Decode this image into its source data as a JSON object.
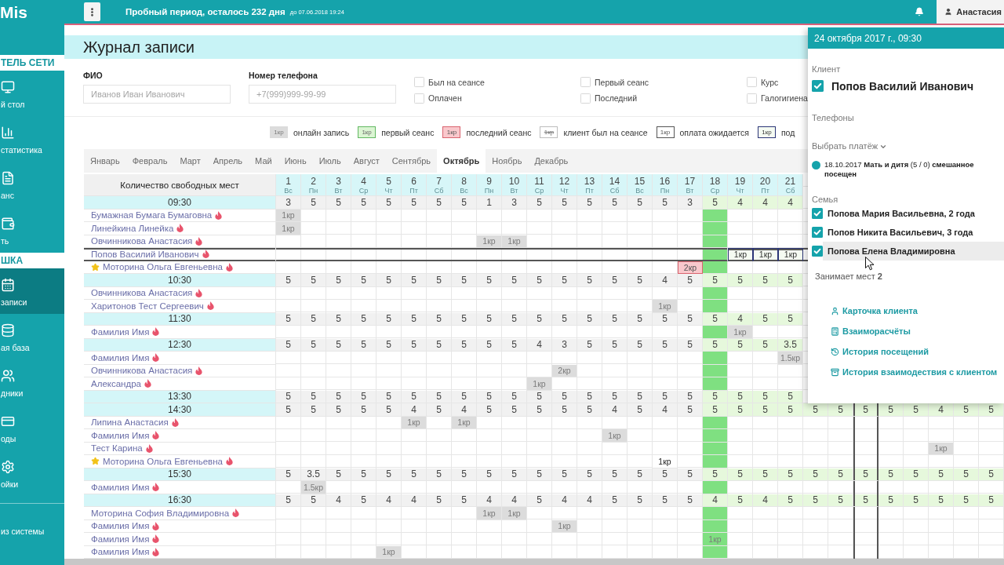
{
  "sidebar": {
    "logo": "Mis",
    "items": [
      {
        "kind": "header",
        "label": "ТЕЛЬ СЕТИ"
      },
      {
        "kind": "link",
        "label": "й стол",
        "selected": false
      },
      {
        "kind": "link",
        "label": "статистика",
        "selected": false
      },
      {
        "kind": "link",
        "label": "анс",
        "selected": false
      },
      {
        "kind": "link",
        "label": "ть",
        "selected": false
      },
      {
        "kind": "header",
        "label": "ШКА"
      },
      {
        "kind": "link",
        "label": "записи",
        "selected": true
      },
      {
        "kind": "link",
        "label": "ая база",
        "selected": false
      },
      {
        "kind": "link",
        "label": "дники",
        "selected": false
      },
      {
        "kind": "link",
        "label": "оды",
        "selected": false
      },
      {
        "kind": "link",
        "label": "ойки",
        "selected": false
      },
      {
        "kind": "footer",
        "label": "из системы",
        "selected": false
      }
    ]
  },
  "top_bar": {
    "trial_notice": "Пробный период, осталось 232 дня",
    "trial_end": "до 07.06.2018 19:24",
    "user": "Анастасия"
  },
  "page_title": "Журнал записи",
  "filters": {
    "fields": [
      {
        "label": "ФИО",
        "placeholder": "Иванов Иван Иванович"
      },
      {
        "label": "Номер телефона",
        "placeholder": "+7(999)999-99-99"
      }
    ],
    "checkbox_groups": [
      {
        "items": [
          {
            "label": "Был на сеансе",
            "checked": false
          },
          {
            "label": "Оплачен",
            "checked": false
          }
        ]
      },
      {
        "items": [
          {
            "label": "Первый сеанс",
            "checked": false
          },
          {
            "label": "Последний",
            "checked": false
          }
        ]
      },
      {
        "items": [
          {
            "label": "Курс",
            "checked": false
          },
          {
            "label": "Галогигиена",
            "checked": false
          }
        ]
      }
    ]
  },
  "legend": [
    {
      "kind": "online",
      "sample": "1кр",
      "label": "онлайн запись"
    },
    {
      "kind": "first",
      "sample": "1кр",
      "label": "первый сеанс"
    },
    {
      "kind": "last",
      "sample": "1кр",
      "label": "последний сеанс"
    },
    {
      "kind": "attended",
      "sample": "1кр",
      "label": "клиент был на сеансе"
    },
    {
      "kind": "awaiting",
      "sample": "1кр",
      "label": "оплата ожидается"
    },
    {
      "kind": "pending",
      "sample": "1кр",
      "label": "под"
    }
  ],
  "months": [
    {
      "label": "Январь",
      "selected": false
    },
    {
      "label": "Февраль",
      "selected": false
    },
    {
      "label": "Март",
      "selected": false
    },
    {
      "label": "Апрель",
      "selected": false
    },
    {
      "label": "Май",
      "selected": false
    },
    {
      "label": "Июнь",
      "selected": false
    },
    {
      "label": "Июль",
      "selected": false
    },
    {
      "label": "Август",
      "selected": false
    },
    {
      "label": "Сентябрь",
      "selected": false
    },
    {
      "label": "Октябрь",
      "selected": true
    },
    {
      "label": "Ноябрь",
      "selected": false
    },
    {
      "label": "Декабрь",
      "selected": false
    }
  ],
  "table": {
    "corner_label": "Количество свободных мест",
    "days": [
      {
        "day": "1",
        "weekday": "Вс",
        "kind": "past",
        "selected": false
      },
      {
        "day": "2",
        "weekday": "Пн",
        "kind": "past",
        "selected": false
      },
      {
        "day": "3",
        "weekday": "Вт",
        "kind": "past",
        "selected": false
      },
      {
        "day": "4",
        "weekday": "Ср",
        "kind": "past",
        "selected": false
      },
      {
        "day": "5",
        "weekday": "Чт",
        "kind": "past",
        "selected": false
      },
      {
        "day": "6",
        "weekday": "Пт",
        "kind": "past",
        "selected": false
      },
      {
        "day": "7",
        "weekday": "Сб",
        "kind": "past",
        "selected": false
      },
      {
        "day": "8",
        "weekday": "Вс",
        "kind": "past",
        "selected": false
      },
      {
        "day": "9",
        "weekday": "Пн",
        "kind": "past",
        "selected": false
      },
      {
        "day": "10",
        "weekday": "Вт",
        "kind": "past",
        "selected": false
      },
      {
        "day": "11",
        "weekday": "Ср",
        "kind": "past",
        "selected": false
      },
      {
        "day": "12",
        "weekday": "Чт",
        "kind": "past",
        "selected": false
      },
      {
        "day": "13",
        "weekday": "Пт",
        "kind": "past",
        "selected": false
      },
      {
        "day": "14",
        "weekday": "Сб",
        "kind": "past",
        "selected": false
      },
      {
        "day": "15",
        "weekday": "Вс",
        "kind": "past",
        "selected": false
      },
      {
        "day": "16",
        "weekday": "Пн",
        "kind": "past",
        "selected": false
      },
      {
        "day": "17",
        "weekday": "Вт",
        "kind": "past",
        "selected": false
      },
      {
        "day": "18",
        "weekday": "Ср",
        "kind": "today",
        "selected": false
      },
      {
        "day": "19",
        "weekday": "Чт",
        "kind": "future",
        "selected": false
      },
      {
        "day": "20",
        "weekday": "Пт",
        "kind": "future",
        "selected": false
      },
      {
        "day": "21",
        "weekday": "Сб",
        "kind": "future",
        "selected": false
      },
      {
        "kind": "future",
        "selected": false
      },
      {
        "kind": "future",
        "selected": false
      },
      {
        "kind": "future",
        "selected": true
      },
      {
        "kind": "future",
        "selected": false
      },
      {
        "kind": "future",
        "selected": false
      },
      {
        "kind": "future",
        "selected": false
      },
      {
        "kind": "future",
        "selected": false
      },
      {
        "kind": "future",
        "selected": false
      }
    ],
    "rows": [
      {
        "kind": "time",
        "time": "09:30",
        "selected": false,
        "counts": [
          "3",
          "5",
          "5",
          "5",
          "5",
          "5",
          "5",
          "5",
          "1",
          "3",
          "5",
          "5",
          "5",
          "5",
          "5",
          "5",
          "3",
          "5",
          "4",
          "4",
          "4"
        ]
      },
      {
        "kind": "client",
        "name": "Бумажная Бумага Бумаговна",
        "starred": false,
        "selected": false,
        "cells": [
          {
            "text": "1кр",
            "kind": "online"
          }
        ]
      },
      {
        "kind": "client",
        "name": "Линейкина Линейка",
        "starred": false,
        "selected": false,
        "cells": [
          {
            "text": "1кр",
            "kind": "online"
          }
        ]
      },
      {
        "kind": "client",
        "name": "Овчинникова Анастасия",
        "starred": false,
        "selected": false,
        "cells": [
          null,
          null,
          null,
          null,
          null,
          null,
          null,
          null,
          {
            "text": "1кр",
            "kind": "online"
          },
          {
            "text": "1кр",
            "kind": "online"
          }
        ]
      },
      {
        "kind": "client",
        "name": "Попов Василий Иванович",
        "starred": false,
        "selected": true,
        "cells": [
          null,
          null,
          null,
          null,
          null,
          null,
          null,
          null,
          null,
          null,
          null,
          null,
          null,
          null,
          null,
          null,
          null,
          null,
          {
            "text": "1кр",
            "kind": "pending"
          },
          {
            "text": "1кр",
            "kind": "pending"
          },
          {
            "text": "1кр",
            "kind": "pending"
          }
        ]
      },
      {
        "kind": "client",
        "name": "Моторина Ольга Евгеньевна",
        "starred": true,
        "selected": false,
        "cells": [
          null,
          null,
          null,
          null,
          null,
          null,
          null,
          null,
          null,
          null,
          null,
          null,
          null,
          null,
          null,
          null,
          {
            "text": "2кр",
            "kind": "last"
          }
        ]
      },
      {
        "kind": "time",
        "time": "10:30",
        "selected": false,
        "counts": [
          "5",
          "5",
          "5",
          "5",
          "5",
          "5",
          "5",
          "5",
          "5",
          "5",
          "5",
          "5",
          "5",
          "5",
          "5",
          "4",
          "5",
          "5",
          "5",
          "5",
          "5"
        ]
      },
      {
        "kind": "client",
        "name": "Овчинникова Анастасия",
        "starred": false,
        "selected": false
      },
      {
        "kind": "client",
        "name": "Харитонов Тест Сергеевич",
        "starred": false,
        "selected": false,
        "cells": [
          null,
          null,
          null,
          null,
          null,
          null,
          null,
          null,
          null,
          null,
          null,
          null,
          null,
          null,
          null,
          {
            "text": "1кр",
            "kind": "online"
          }
        ]
      },
      {
        "kind": "time",
        "time": "11:30",
        "selected": false,
        "counts": [
          "5",
          "5",
          "5",
          "5",
          "5",
          "5",
          "5",
          "5",
          "5",
          "5",
          "5",
          "5",
          "5",
          "5",
          "5",
          "5",
          "5",
          "5",
          "4",
          "5",
          "5"
        ]
      },
      {
        "kind": "client",
        "name": "Фамилия Имя",
        "starred": false,
        "selected": false,
        "cells": [
          null,
          null,
          null,
          null,
          null,
          null,
          null,
          null,
          null,
          null,
          null,
          null,
          null,
          null,
          null,
          null,
          null,
          null,
          {
            "text": "1кр",
            "kind": "online"
          }
        ]
      },
      {
        "kind": "time",
        "time": "12:30",
        "selected": false,
        "counts": [
          "5",
          "5",
          "5",
          "5",
          "5",
          "5",
          "5",
          "5",
          "5",
          "5",
          "4",
          "3",
          "5",
          "5",
          "5",
          "5",
          "5",
          "5",
          "5",
          "5",
          "3.5"
        ]
      },
      {
        "kind": "client",
        "name": "Фамилия Имя",
        "starred": false,
        "selected": false,
        "cells": [
          null,
          null,
          null,
          null,
          null,
          null,
          null,
          null,
          null,
          null,
          null,
          null,
          null,
          null,
          null,
          null,
          null,
          null,
          null,
          null,
          {
            "text": "1.5кр",
            "kind": "online"
          }
        ]
      },
      {
        "kind": "client",
        "name": "Овчинникова Анастасия",
        "starred": false,
        "selected": false,
        "cells": [
          null,
          null,
          null,
          null,
          null,
          null,
          null,
          null,
          null,
          null,
          null,
          {
            "text": "2кр",
            "kind": "online"
          }
        ]
      },
      {
        "kind": "client",
        "name": "Александра",
        "starred": false,
        "selected": false,
        "cells": [
          null,
          null,
          null,
          null,
          null,
          null,
          null,
          null,
          null,
          null,
          {
            "text": "1кр",
            "kind": "online"
          }
        ]
      },
      {
        "kind": "time",
        "time": "13:30",
        "selected": false,
        "counts": [
          "5",
          "5",
          "5",
          "5",
          "5",
          "5",
          "5",
          "5",
          "5",
          "5",
          "5",
          "5",
          "5",
          "5",
          "5",
          "5",
          "5",
          "5",
          "5",
          "5",
          "5"
        ]
      },
      {
        "kind": "time",
        "time": "14:30",
        "selected": false,
        "counts": [
          "5",
          "5",
          "5",
          "5",
          "5",
          "4",
          "5",
          "4",
          "5",
          "5",
          "5",
          "5",
          "5",
          "4",
          "5",
          "4",
          "5",
          "5",
          "5",
          "5",
          "5",
          "5",
          "5",
          "5",
          "5",
          "5",
          "4",
          "5",
          "5"
        ]
      },
      {
        "kind": "client",
        "name": "Липина Анастасия",
        "starred": false,
        "selected": false,
        "cells": [
          null,
          null,
          null,
          null,
          null,
          {
            "text": "1кр",
            "kind": "online"
          },
          null,
          {
            "text": "1кр",
            "kind": "online"
          }
        ]
      },
      {
        "kind": "client",
        "name": "Фамилия Имя",
        "starred": false,
        "selected": false,
        "cells": [
          null,
          null,
          null,
          null,
          null,
          null,
          null,
          null,
          null,
          null,
          null,
          null,
          null,
          {
            "text": "1кр",
            "kind": "online"
          }
        ]
      },
      {
        "kind": "client",
        "name": "Тест Карина",
        "starred": false,
        "selected": false,
        "cells": [
          null,
          null,
          null,
          null,
          null,
          null,
          null,
          null,
          null,
          null,
          null,
          null,
          null,
          null,
          null,
          null,
          null,
          null,
          null,
          null,
          null,
          null,
          null,
          null,
          null,
          null,
          {
            "text": "1кр",
            "kind": "online"
          }
        ]
      },
      {
        "kind": "client",
        "name": "Моторина Ольга Евгеньевна",
        "starred": true,
        "selected": false,
        "cells": [
          null,
          null,
          null,
          null,
          null,
          null,
          null,
          null,
          null,
          null,
          null,
          null,
          null,
          null,
          null,
          {
            "text": "1кр",
            "kind": "plain"
          }
        ]
      },
      {
        "kind": "time",
        "time": "15:30",
        "selected": false,
        "counts": [
          "5",
          "3.5",
          "5",
          "5",
          "5",
          "5",
          "5",
          "5",
          "5",
          "5",
          "5",
          "5",
          "5",
          "5",
          "5",
          "5",
          "5",
          "5",
          "5",
          "5",
          "5",
          "5",
          "5",
          "5",
          "5",
          "5",
          "5",
          "5",
          "5"
        ]
      },
      {
        "kind": "client",
        "name": "Фамилия Имя",
        "starred": false,
        "selected": false,
        "cells": [
          null,
          {
            "text": "1.5кр",
            "kind": "online"
          }
        ]
      },
      {
        "kind": "time",
        "time": "16:30",
        "selected": false,
        "counts": [
          "5",
          "5",
          "4",
          "5",
          "4",
          "4",
          "5",
          "5",
          "4",
          "4",
          "5",
          "4",
          "4",
          "5",
          "5",
          "5",
          "5",
          "4",
          "5",
          "4",
          "5",
          "5",
          "5",
          "5",
          "5",
          "5",
          "5",
          "5",
          "5"
        ]
      },
      {
        "kind": "client",
        "name": "Моторина София Владимировна",
        "starred": false,
        "selected": false,
        "cells": [
          null,
          null,
          null,
          null,
          null,
          null,
          null,
          null,
          {
            "text": "1кр",
            "kind": "online"
          },
          {
            "text": "1кр",
            "kind": "online"
          }
        ]
      },
      {
        "kind": "client",
        "name": "Фамилия Имя",
        "starred": false,
        "selected": false,
        "cells": [
          null,
          null,
          null,
          null,
          null,
          null,
          null,
          null,
          null,
          null,
          null,
          {
            "text": "1кр",
            "kind": "online"
          }
        ]
      },
      {
        "kind": "client",
        "name": "Фамилия Имя",
        "starred": false,
        "selected": false,
        "cells": [
          null,
          null,
          null,
          null,
          null,
          null,
          null,
          null,
          null,
          null,
          null,
          null,
          null,
          null,
          null,
          null,
          null,
          {
            "text": "1кр",
            "kind": "online"
          }
        ]
      },
      {
        "kind": "client",
        "name": "Фамилия Имя",
        "starred": false,
        "selected": false,
        "cells": [
          null,
          null,
          null,
          null,
          {
            "text": "1кр",
            "kind": "online"
          }
        ]
      }
    ]
  },
  "client_panel": {
    "title": "24 октября 2017 г., 09:30",
    "client_label": "Клиент",
    "client": {
      "name": "Попов Василий Иванович",
      "checked": true
    },
    "phones_label": "Телефоны",
    "payment_label": "Выбрать платёж",
    "payment": "18.10.2017 **Мать и дитя** (5 / 0) **смешанное посещен**",
    "family_label": "Семья",
    "family": [
      {
        "name": "Попова Мария Васильевна, 2 года",
        "checked": true,
        "hovered": false
      },
      {
        "name": "Попов Никита Васильевич, 3 года",
        "checked": true,
        "hovered": false
      },
      {
        "name": "Попова Елена Владимировна",
        "checked": true,
        "hovered": true
      }
    ],
    "seats": "Занимает мест **2**",
    "links": [
      "Карточка клиента",
      "Взаиморасчёты",
      "История посещений",
      "История взаимодествия с клиентом"
    ]
  }
}
